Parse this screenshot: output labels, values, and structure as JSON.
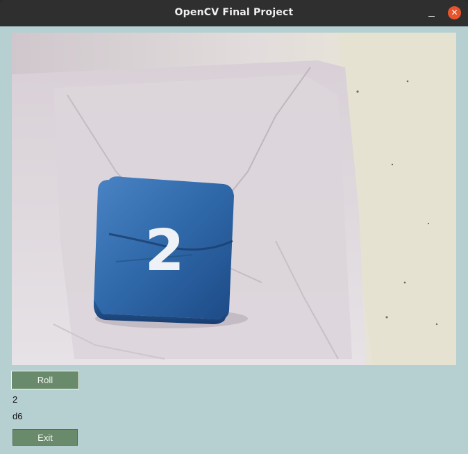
{
  "window": {
    "title": "OpenCV Final Project",
    "minimize_glyph": "–",
    "close_glyph": "✕"
  },
  "camera": {
    "die_face_value": "2"
  },
  "controls": {
    "roll_label": "Roll",
    "result_value": "2",
    "die_type": "d6",
    "exit_label": "Exit"
  },
  "colors": {
    "titlebar": "#2f2f2f",
    "client_bg": "#b6cfd0",
    "button_bg": "#6a8a6c",
    "close_button": "#e9542b",
    "die_blue": "#2e65a6"
  },
  "icons": [
    "minimize-icon",
    "close-icon"
  ]
}
